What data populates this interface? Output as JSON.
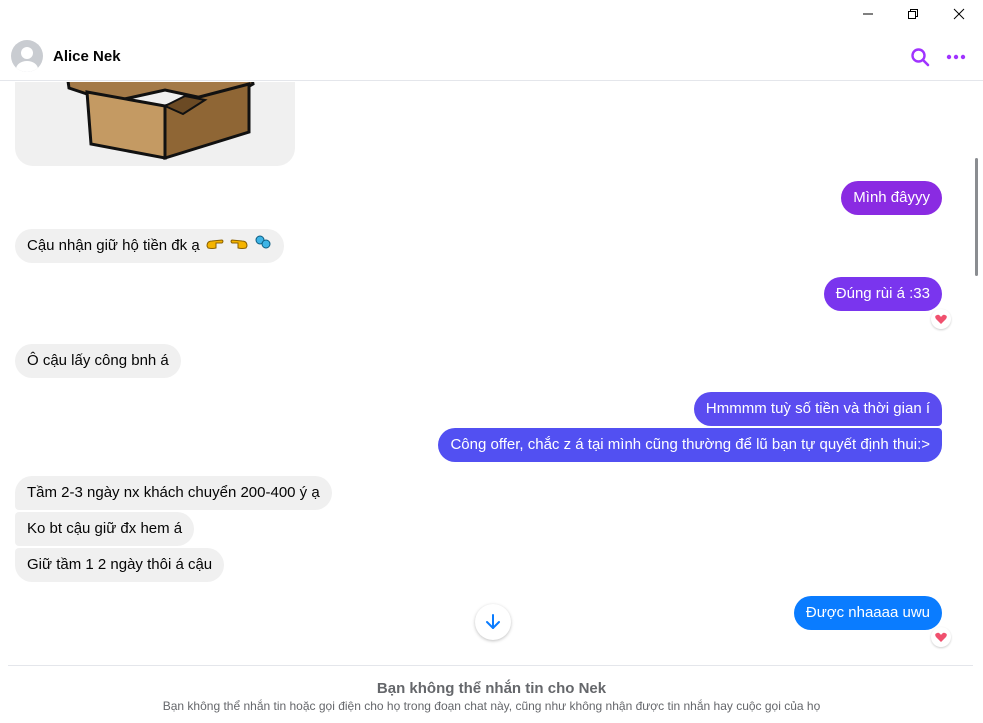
{
  "window": {
    "minimize_icon": "minimize-icon",
    "restore_icon": "restore-icon",
    "close_icon": "close-icon"
  },
  "header": {
    "contact_name": "Alice Nek",
    "search_icon": "search-icon",
    "more_icon": "more-icon"
  },
  "colors": {
    "accent": "#a033ff",
    "outgoing_purple": "#8a2be2",
    "outgoing_indigo": "#5b4cf0",
    "outgoing_blue": "#0a7cff",
    "incoming": "#f0f0f0",
    "reaction_heart": "#f0506e"
  },
  "messages": [
    {
      "id": "m1",
      "direction": "in",
      "type": "image",
      "content": "cardboard-box-sticker"
    },
    {
      "id": "m2",
      "direction": "out",
      "text": "Mình đâyyy"
    },
    {
      "id": "m3",
      "direction": "in",
      "text": "Cậu nhận giữ hộ tiền đk ạ",
      "emojis": [
        "pointing-right-emoji",
        "pointing-left-emoji",
        "sparkle-emoji"
      ]
    },
    {
      "id": "m4",
      "direction": "out",
      "text": "Đúng rùi á :33",
      "reaction": "heart"
    },
    {
      "id": "m5",
      "direction": "in",
      "text": "Ô cậu lấy công bnh á"
    },
    {
      "id": "m6",
      "direction": "out",
      "text": "Hmmmm tuỳ số tiền và thời gian í"
    },
    {
      "id": "m7",
      "direction": "out",
      "text": "Công offer, chắc z á tại mình cũng thường để lũ bạn tự quyết định thui:>"
    },
    {
      "id": "m8",
      "direction": "in",
      "text": "Tầm 2-3 ngày nx khách chuyển 200-400 ý ạ"
    },
    {
      "id": "m9",
      "direction": "in",
      "text": "Ko bt cậu giữ đx hem á"
    },
    {
      "id": "m10",
      "direction": "in",
      "text": "Giữ tầm 1 2 ngày thôi á cậu"
    },
    {
      "id": "m11",
      "direction": "out",
      "text": "Được nhaaaa uwu",
      "reaction": "heart"
    }
  ],
  "scroll_down_icon": "arrow-down-icon",
  "footer": {
    "title": "Bạn không thể nhắn tin cho Nek",
    "subtitle": "Bạn không thể nhắn tin hoặc gọi điện cho họ trong đoạn chat này, cũng như không nhận được tin nhắn hay cuộc gọi của họ"
  }
}
